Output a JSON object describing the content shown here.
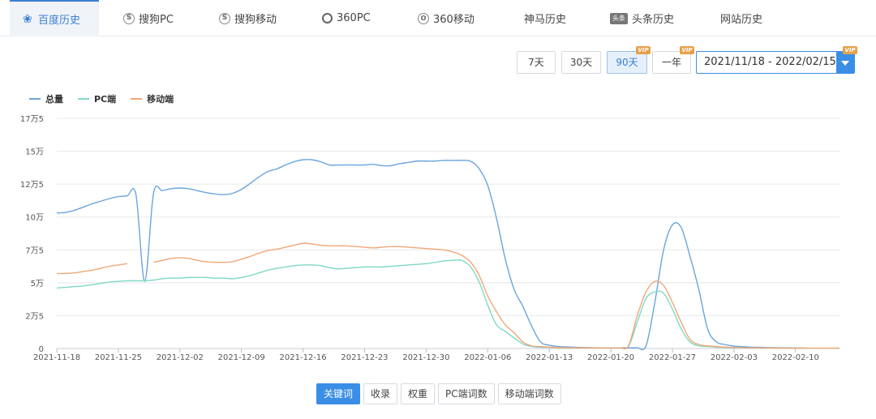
{
  "tabs": [
    {
      "label": "百度历史",
      "icon": "paw-icon",
      "active": true
    },
    {
      "label": "搜狗PC",
      "icon": "sogou-icon"
    },
    {
      "label": "搜狗移动",
      "icon": "sogou-icon"
    },
    {
      "label": "360PC",
      "icon": "360-icon"
    },
    {
      "label": "360移动",
      "icon": "360-mobile-icon"
    },
    {
      "label": "神马历史",
      "icon": ""
    },
    {
      "label": "头条历史",
      "icon": "toutiao-icon",
      "icon_text": "头条"
    },
    {
      "label": "网站历史",
      "icon": ""
    }
  ],
  "range_buttons": {
    "d7": "7天",
    "d30": "30天",
    "d90": "90天",
    "y1": "一年",
    "vip": "VIP"
  },
  "date_range": "2021/11/18 - 2022/02/15",
  "bottom_tabs": [
    "关键词",
    "收录",
    "权重",
    "PC端词数",
    "移动端词数"
  ],
  "colors": {
    "total": "#6aa5dd",
    "pc": "#7fd8c4",
    "mobile": "#f0a878",
    "accent": "#3a8ee6"
  },
  "chart_data": {
    "type": "line",
    "x": [
      "2021-11-18",
      "2021-11-19",
      "2021-11-20",
      "2021-11-21",
      "2021-11-22",
      "2021-11-23",
      "2021-11-24",
      "2021-11-25",
      "2021-11-26",
      "2021-11-27",
      "2021-11-28",
      "2021-11-29",
      "2021-11-30",
      "2021-12-01",
      "2021-12-02",
      "2021-12-03",
      "2021-12-04",
      "2021-12-05",
      "2021-12-06",
      "2021-12-07",
      "2021-12-08",
      "2021-12-09",
      "2021-12-10",
      "2021-12-11",
      "2021-12-12",
      "2021-12-13",
      "2021-12-14",
      "2021-12-15",
      "2021-12-16",
      "2021-12-17",
      "2021-12-18",
      "2021-12-19",
      "2021-12-20",
      "2021-12-21",
      "2021-12-22",
      "2021-12-23",
      "2021-12-24",
      "2021-12-25",
      "2021-12-26",
      "2021-12-27",
      "2021-12-28",
      "2021-12-29",
      "2021-12-30",
      "2021-12-31",
      "2022-01-01",
      "2022-01-02",
      "2022-01-03",
      "2022-01-04",
      "2022-01-05",
      "2022-01-06",
      "2022-01-07",
      "2022-01-08",
      "2022-01-09",
      "2022-01-10",
      "2022-01-11",
      "2022-01-12",
      "2022-01-13",
      "2022-01-14",
      "2022-01-15",
      "2022-01-16",
      "2022-01-17",
      "2022-01-18",
      "2022-01-19",
      "2022-01-20",
      "2022-01-21",
      "2022-01-22",
      "2022-01-23",
      "2022-01-24",
      "2022-01-25",
      "2022-01-26",
      "2022-01-27",
      "2022-01-28",
      "2022-01-29",
      "2022-01-30",
      "2022-01-31",
      "2022-02-01",
      "2022-02-02",
      "2022-02-03",
      "2022-02-04",
      "2022-02-05",
      "2022-02-06",
      "2022-02-07",
      "2022-02-08",
      "2022-02-09",
      "2022-02-10",
      "2022-02-11",
      "2022-02-12",
      "2022-02-13",
      "2022-02-14",
      "2022-02-15"
    ],
    "series": [
      {
        "name": "总量",
        "color": "#6aa5dd",
        "values": [
          103000,
          103500,
          105000,
          107500,
          110000,
          112000,
          114000,
          115500,
          116000,
          117000,
          51000,
          118000,
          120000,
          121500,
          122000,
          121500,
          120000,
          118500,
          117500,
          117000,
          118000,
          121000,
          125500,
          130500,
          134500,
          136500,
          139500,
          142000,
          143500,
          143500,
          142000,
          139500,
          139500,
          139500,
          139500,
          139500,
          140000,
          139000,
          139000,
          140500,
          141500,
          142500,
          142500,
          142500,
          143000,
          143000,
          143000,
          142500,
          137000,
          124000,
          99000,
          68000,
          45000,
          32000,
          17000,
          5000,
          2500,
          1500,
          1200,
          900,
          700,
          600,
          500,
          500,
          500,
          500,
          600,
          2000,
          35000,
          75000,
          94000,
          92000,
          70000,
          45000,
          15000,
          5000,
          3000,
          1800,
          1400,
          1000,
          900,
          700,
          600,
          500,
          400,
          400
        ]
      },
      {
        "name": "PC端",
        "color": "#7fd8c4",
        "values": [
          46000,
          46500,
          47000,
          47500,
          48500,
          49500,
          50500,
          51000,
          51500,
          51500,
          51500,
          52000,
          53000,
          53500,
          53500,
          54000,
          54000,
          54000,
          53500,
          53500,
          53000,
          54000,
          55500,
          57500,
          59500,
          61000,
          62000,
          63000,
          63500,
          63500,
          63000,
          61500,
          60500,
          61000,
          61500,
          62000,
          62000,
          62000,
          62500,
          63000,
          63500,
          64000,
          64500,
          65500,
          66500,
          67000,
          67000,
          62500,
          51000,
          33000,
          18000,
          13000,
          8000,
          3500,
          1500,
          1000,
          800,
          600,
          500,
          400,
          400,
          400,
          400,
          400,
          500,
          1500,
          20000,
          38000,
          43000,
          42000,
          30000,
          15000,
          5000,
          2000,
          1500,
          1000,
          800,
          600,
          500,
          400,
          400,
          400,
          300,
          300,
          300,
          300,
          300,
          300,
          300,
          300
        ]
      },
      {
        "name": "移动端",
        "color": "#f0a878",
        "values": [
          57000,
          57000,
          57500,
          58500,
          59500,
          61000,
          62500,
          63500,
          64500,
          null,
          null,
          65500,
          67000,
          68500,
          69000,
          68500,
          67000,
          66000,
          65500,
          65500,
          66000,
          68000,
          70000,
          72500,
          74500,
          75500,
          77000,
          78500,
          80000,
          79500,
          78500,
          78000,
          78000,
          78000,
          77500,
          77000,
          76500,
          77000,
          77500,
          77500,
          77000,
          76500,
          76000,
          75500,
          75000,
          73500,
          71000,
          66000,
          56000,
          40000,
          28000,
          18000,
          12000,
          5000,
          2000,
          1500,
          1000,
          700,
          600,
          500,
          400,
          400,
          400,
          400,
          500,
          2000,
          25000,
          43000,
          51000,
          48000,
          35000,
          20000,
          7000,
          3000,
          2000,
          1500,
          1000,
          800,
          600,
          500,
          400,
          400,
          300,
          300,
          300,
          300,
          300,
          300,
          300,
          300
        ]
      }
    ],
    "xticks": [
      "2021-11-18",
      "2021-11-25",
      "2021-12-02",
      "2021-12-09",
      "2021-12-16",
      "2021-12-23",
      "2021-12-30",
      "2022-01-06",
      "2022-01-13",
      "2022-01-20",
      "2022-01-27",
      "2022-02-03",
      "2022-02-10"
    ],
    "yticks": [
      0,
      25000,
      50000,
      75000,
      100000,
      125000,
      150000,
      175000
    ],
    "ytick_labels": [
      "0",
      "2万5",
      "5万",
      "7万5",
      "10万",
      "12万5",
      "15万",
      "17万5"
    ],
    "ylim": [
      0,
      175000
    ],
    "grid": true,
    "legend_position": "top-left"
  }
}
